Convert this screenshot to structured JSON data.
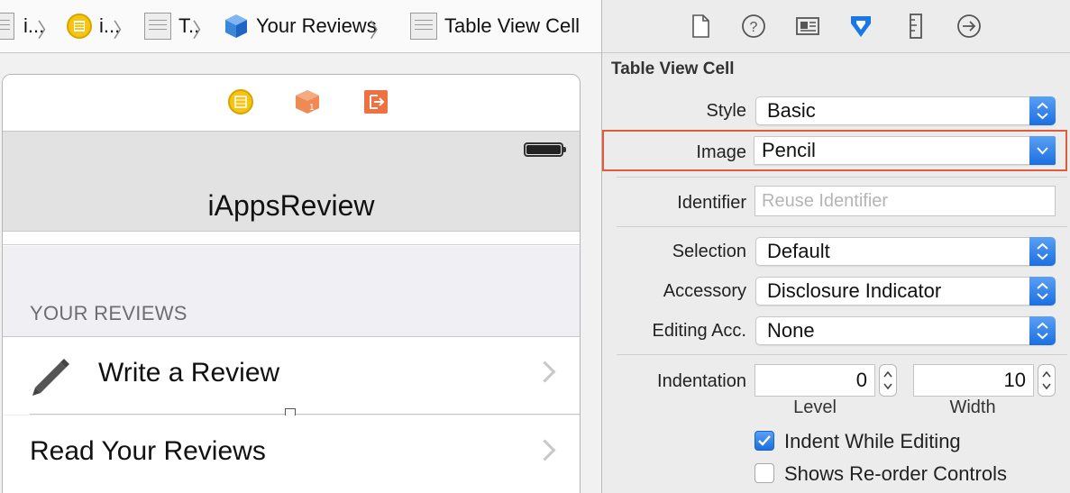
{
  "breadcrumb": {
    "items": [
      {
        "label": "",
        "icon": "storyboard-icon"
      },
      {
        "label": "i...",
        "icon": "storyboard-file-icon"
      },
      {
        "label": "i...",
        "icon": "scene-icon"
      },
      {
        "label": "T..",
        "icon": "table-view-icon"
      },
      {
        "label": "Your Reviews",
        "icon": "section-cube-icon"
      },
      {
        "label": "Table View Cell",
        "icon": "table-cell-icon"
      }
    ]
  },
  "canvas": {
    "nav_title": "iAppsReview",
    "section_header": "YOUR REVIEWS",
    "cells": [
      {
        "label": "Write a Review",
        "icon": "pencil-icon"
      },
      {
        "label": "Read Your Reviews"
      }
    ]
  },
  "inspector": {
    "section_title": "Table View Cell",
    "fields": {
      "style": {
        "label": "Style",
        "value": "Basic"
      },
      "image": {
        "label": "Image",
        "value": "Pencil"
      },
      "identifier": {
        "label": "Identifier",
        "placeholder": "Reuse Identifier"
      },
      "selection": {
        "label": "Selection",
        "value": "Default"
      },
      "accessory": {
        "label": "Accessory",
        "value": "Disclosure Indicator"
      },
      "editing_acc": {
        "label": "Editing Acc.",
        "value": "None"
      },
      "indentation": {
        "label": "Indentation",
        "level": "0",
        "width": "10",
        "level_label": "Level",
        "width_label": "Width"
      }
    },
    "checkboxes": {
      "indent_while_editing": {
        "label": "Indent While Editing",
        "checked": true
      },
      "shows_reorder": {
        "label": "Shows Re-order Controls",
        "checked": false
      }
    }
  },
  "colors": {
    "accent": "#1a6fe0",
    "highlight": "#e15a3c",
    "active_tab": "#1a78e6"
  }
}
